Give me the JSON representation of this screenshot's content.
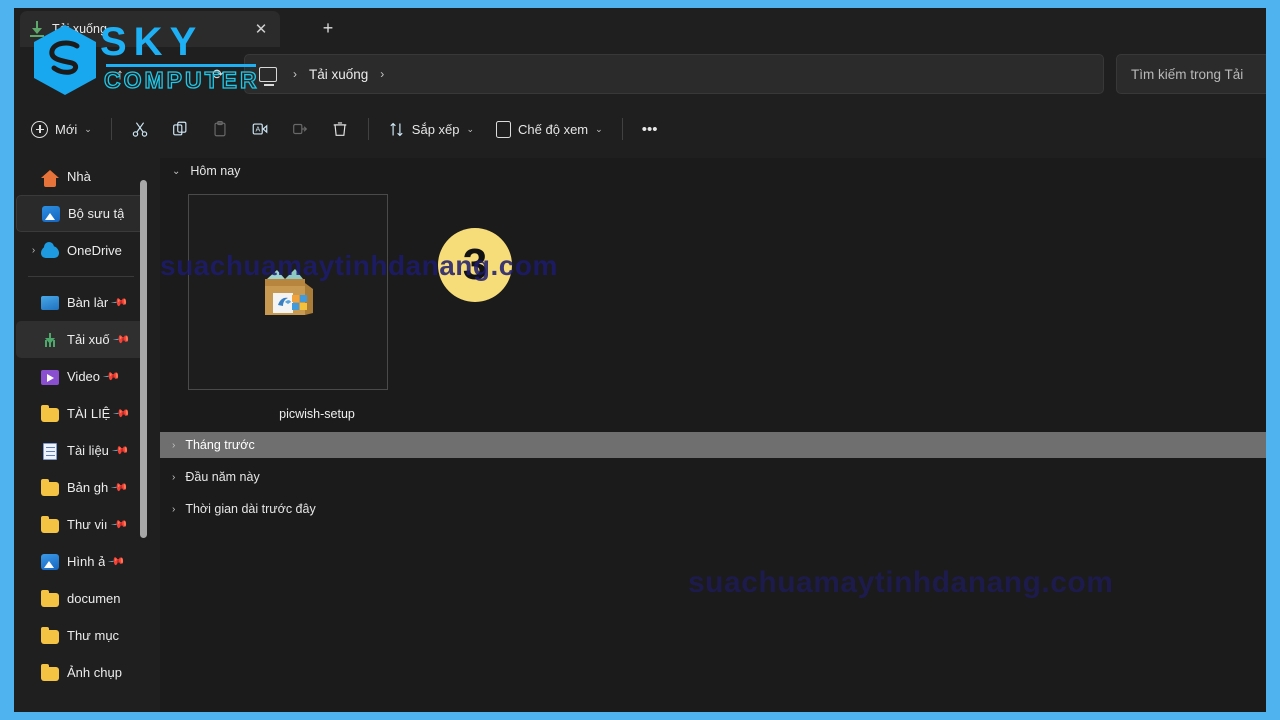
{
  "theme": {
    "frame_blue": "#4fb3ef",
    "window_bg": "#1f1f1f",
    "content_bg": "#1b1b1b",
    "badge_yellow": "#f7dd7a",
    "accent_logo_blue": "#1eb0f5",
    "accent_logo_cyan": "#1ec8e8",
    "watermark_blue": "#1d1b6e"
  },
  "logo": {
    "line1": "SKY",
    "line2": "COMPUTER"
  },
  "watermarks": {
    "top": "suachuamaytinhdanang.com",
    "middle": "suachuamaytinhdanang.com"
  },
  "titlebar": {
    "tab_label": "Tải xuống",
    "tab_icon": "download-icon",
    "close_label": "✕",
    "newtab_label": "+"
  },
  "addressbar": {
    "back_label": "‹",
    "forward_label": "›",
    "up_label": "↑",
    "refresh_label": "⟳",
    "pc_icon": "this-pc-icon",
    "crumb_sep": "›",
    "crumb": "Tải xuống",
    "crumb_tail": "›",
    "search_placeholder": "Tìm kiếm trong Tải"
  },
  "toolbar": {
    "new_label": "Mới",
    "new_caret": "⌄",
    "cut_icon": "cut-icon",
    "copy_icon": "copy-icon",
    "paste_icon": "paste-icon",
    "rename_icon": "rename-icon",
    "share_icon": "share-icon",
    "delete_icon": "delete-icon",
    "sort_label": "Sắp xếp",
    "sort_caret": "⌄",
    "sort_icon": "sort-arrows-icon",
    "view_label": "Chế độ xem",
    "view_caret": "⌄",
    "view_icon": "view-layout-icon",
    "more_label": "•••"
  },
  "sidebar": {
    "items": [
      {
        "label": "Nhà",
        "icon": "home-icon",
        "expand": "",
        "pinned": false,
        "state": "normal"
      },
      {
        "label": "Bộ sưu tậ",
        "icon": "gallery-icon",
        "expand": "",
        "pinned": false,
        "state": "hover"
      },
      {
        "label": "OneDrive",
        "icon": "onedrive-cloud-icon",
        "expand": "›",
        "pinned": false,
        "state": "normal"
      },
      {
        "label": "Bàn làr",
        "icon": "desktop-icon",
        "expand": "",
        "pinned": true,
        "state": "normal"
      },
      {
        "label": "Tải xuố",
        "icon": "downloads-icon",
        "expand": "",
        "pinned": true,
        "state": "selected"
      },
      {
        "label": "Video",
        "icon": "video-icon",
        "expand": "",
        "pinned": true,
        "state": "normal"
      },
      {
        "label": "TÀI LIỆ",
        "icon": "folder-icon",
        "expand": "",
        "pinned": true,
        "state": "normal"
      },
      {
        "label": "Tài liệu",
        "icon": "documents-icon",
        "expand": "",
        "pinned": true,
        "state": "normal"
      },
      {
        "label": "Bản gh",
        "icon": "folder-icon",
        "expand": "",
        "pinned": true,
        "state": "normal"
      },
      {
        "label": "Thư viı",
        "icon": "folder-icon",
        "expand": "",
        "pinned": true,
        "state": "normal"
      },
      {
        "label": "Hình ả",
        "icon": "pictures-icon",
        "expand": "",
        "pinned": true,
        "state": "normal"
      },
      {
        "label": "documen",
        "icon": "folder-icon",
        "expand": "",
        "pinned": false,
        "state": "normal"
      },
      {
        "label": "Thư mục",
        "icon": "folder-icon",
        "expand": "",
        "pinned": false,
        "state": "normal"
      },
      {
        "label": "Ảnh chụp",
        "icon": "folder-icon",
        "expand": "",
        "pinned": false,
        "state": "normal"
      }
    ],
    "pin_glyph": "📌",
    "divider_after_index": 2
  },
  "content": {
    "groups": [
      {
        "label": "Hôm nay",
        "chevron": "⌄",
        "highlight": false
      },
      {
        "label": "Tháng trước",
        "chevron": "›",
        "highlight": true
      },
      {
        "label": "Đầu năm này",
        "chevron": "›",
        "highlight": false
      },
      {
        "label": "Thời gian dài trước đây",
        "chevron": "›",
        "highlight": false
      }
    ],
    "files": [
      {
        "name": "picwish-setup",
        "icon": "installer-package-icon",
        "selected": true
      }
    ],
    "badge": {
      "value": "3",
      "name": "step-badge-3"
    }
  }
}
